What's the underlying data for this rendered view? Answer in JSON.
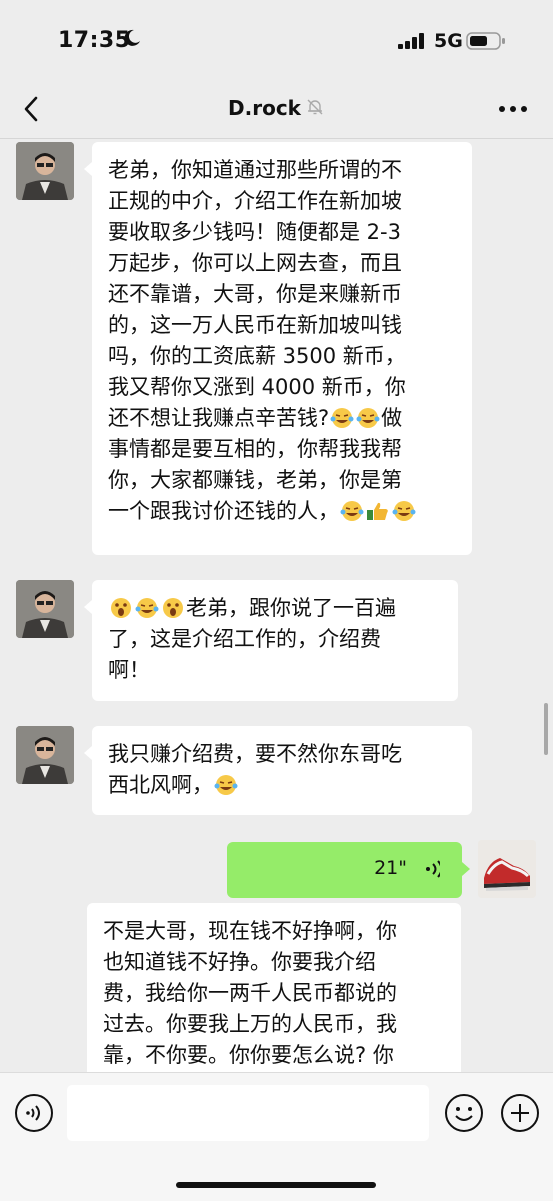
{
  "status_bar": {
    "time": "17:35",
    "network": "5G"
  },
  "nav": {
    "title": "D.rock"
  },
  "messages": [
    {
      "from": "contact",
      "type": "text",
      "lines": [
        "老弟，你知道通过那些所谓的不",
        "正规的中介，介绍工作在新加坡",
        "要收取多少钱吗！随便都是 2-3",
        "万起步，你可以上网去查，而且",
        "还不靠谱，大哥，你是来赚新币",
        "的，这一万人民币在新加坡叫钱",
        "吗，你的工资底薪 3500 新币，",
        "我又帮你又涨到 4000 新币，你",
        "还不想让我赚点辛苦钱?",
        "事情都是要互相的，你帮我我帮",
        "你，大家都赚钱，老弟，你是第",
        "一个跟我讨价还钱的人，"
      ],
      "line9_tail": "做"
    },
    {
      "from": "contact",
      "type": "text",
      "lines": [
        "老弟，跟你说了一百遍",
        "了，这是介绍工作的，介绍费",
        "啊！"
      ]
    },
    {
      "from": "contact",
      "type": "text",
      "lines": [
        "我只赚介绍费，要不然你东哥吃",
        "西北风啊，"
      ]
    },
    {
      "from": "me",
      "type": "voice",
      "duration": "21\""
    },
    {
      "from": "contact",
      "type": "text",
      "lines": [
        "不是大哥，现在钱不好挣啊，你",
        "也知道钱不好挣。你要我介绍",
        "费，我给你一两千人民币都说的",
        "过去。你要我上万的人民币，我",
        "靠，不你要。你你要怎么说? 你"
      ]
    }
  ],
  "icons": {
    "status": [
      "moon-icon",
      "signal-icon",
      "battery-icon"
    ],
    "nav": [
      "back-icon",
      "mute-bell-icon",
      "more-icon"
    ],
    "input": [
      "voice-input-icon",
      "emoji-icon",
      "plus-icon"
    ],
    "emoji": [
      "laugh-cry-emoji",
      "shocked-emoji",
      "thumbs-up-emoji"
    ]
  },
  "colors": {
    "background": "#ededed",
    "my_bubble": "#95ec69",
    "contact_bubble": "#ffffff"
  }
}
